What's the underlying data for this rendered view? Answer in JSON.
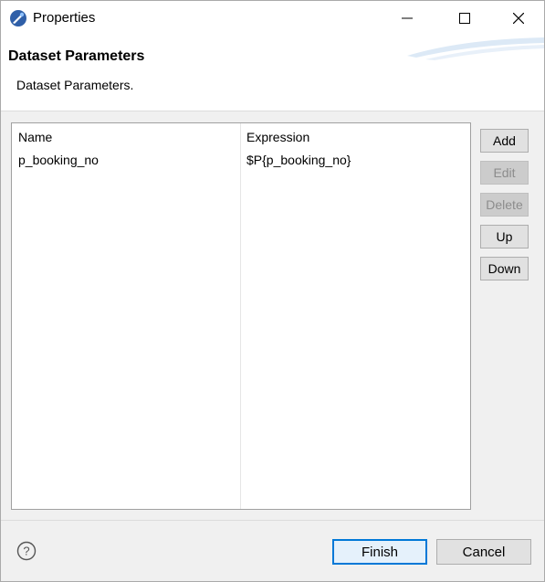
{
  "window": {
    "title": "Properties"
  },
  "header": {
    "title": "Dataset Parameters",
    "description": "Dataset Parameters."
  },
  "table": {
    "columns": [
      "Name",
      "Expression"
    ],
    "rows": [
      {
        "name": "p_booking_no",
        "expression": "$P{p_booking_no}"
      }
    ]
  },
  "side_buttons": {
    "add": "Add",
    "edit": "Edit",
    "delete": "Delete",
    "up": "Up",
    "down": "Down"
  },
  "footer": {
    "finish": "Finish",
    "cancel": "Cancel"
  },
  "icons": {
    "app": "eclipse-app-icon",
    "help": "help-icon",
    "minimize": "minimize-icon",
    "maximize": "maximize-icon",
    "close": "close-icon"
  },
  "colors": {
    "default_button_border": "#0078d7",
    "disabled_text": "#8c8c8c"
  }
}
